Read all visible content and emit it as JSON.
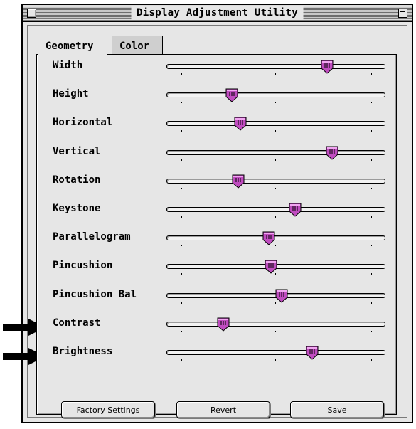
{
  "window": {
    "title": "Display Adjustment Utility"
  },
  "tabs": [
    {
      "label": "Geometry",
      "active": true
    },
    {
      "label": "Color",
      "active": false
    }
  ],
  "sliders": [
    {
      "label": "Width",
      "value": 0.74
    },
    {
      "label": "Height",
      "value": 0.3
    },
    {
      "label": "Horizontal",
      "value": 0.34
    },
    {
      "label": "Vertical",
      "value": 0.76
    },
    {
      "label": "Rotation",
      "value": 0.33
    },
    {
      "label": "Keystone",
      "value": 0.59
    },
    {
      "label": "Parallelogram",
      "value": 0.47
    },
    {
      "label": "Pincushion",
      "value": 0.48
    },
    {
      "label": "Pincushion Bal",
      "value": 0.53
    },
    {
      "label": "Contrast",
      "value": 0.26
    },
    {
      "label": "Brightness",
      "value": 0.67
    }
  ],
  "buttons": {
    "factory_settings": "Factory Settings",
    "revert": "Revert",
    "save": "Save"
  },
  "colors": {
    "thumb": "#c04cc0",
    "thumb_light": "#f2a6f2",
    "window_bg": "#e6e6e6"
  },
  "annotations": {
    "arrow_targets": [
      "Contrast",
      "Brightness"
    ]
  }
}
